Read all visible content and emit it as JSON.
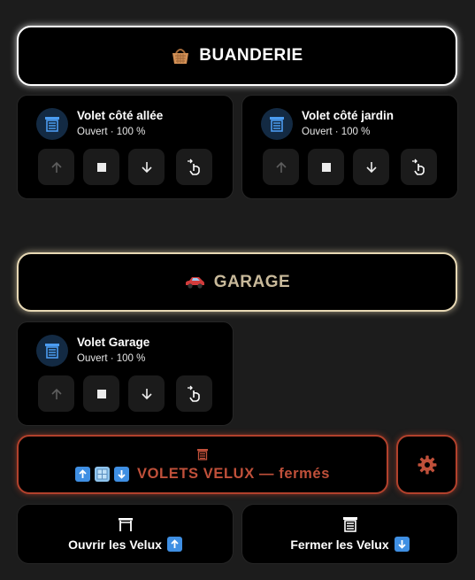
{
  "sections": {
    "buanderie": {
      "title": "BUANDERIE",
      "icon": "laundry-basket-emoji"
    },
    "garage": {
      "title": "GARAGE",
      "icon": "car-emoji"
    }
  },
  "covers": [
    {
      "name": "Volet côté allée",
      "state": "Ouvert · 100 %",
      "icon": "window-shutter-icon"
    },
    {
      "name": "Volet côté jardin",
      "state": "Ouvert · 100 %",
      "icon": "window-shutter-icon"
    },
    {
      "name": "Volet Garage",
      "state": "Ouvert · 100 %",
      "icon": "window-shutter-icon"
    }
  ],
  "cover_buttons": [
    "arrow-up-icon",
    "stop-icon",
    "arrow-down-icon",
    "tilt-hand-icon"
  ],
  "velux": {
    "status_label": "VOLETS VELUX — fermés",
    "status_color": "#c0503a",
    "border_color": "#b2412c",
    "settings_icon": "gear-icon",
    "open_label": "Ouvrir les Velux",
    "close_label": "Fermer les Velux"
  },
  "colors": {
    "background": "#1c1c1c",
    "card": "#000000",
    "shutter_blue": "#4b9cf0",
    "garage_text": "#c8b99a"
  }
}
